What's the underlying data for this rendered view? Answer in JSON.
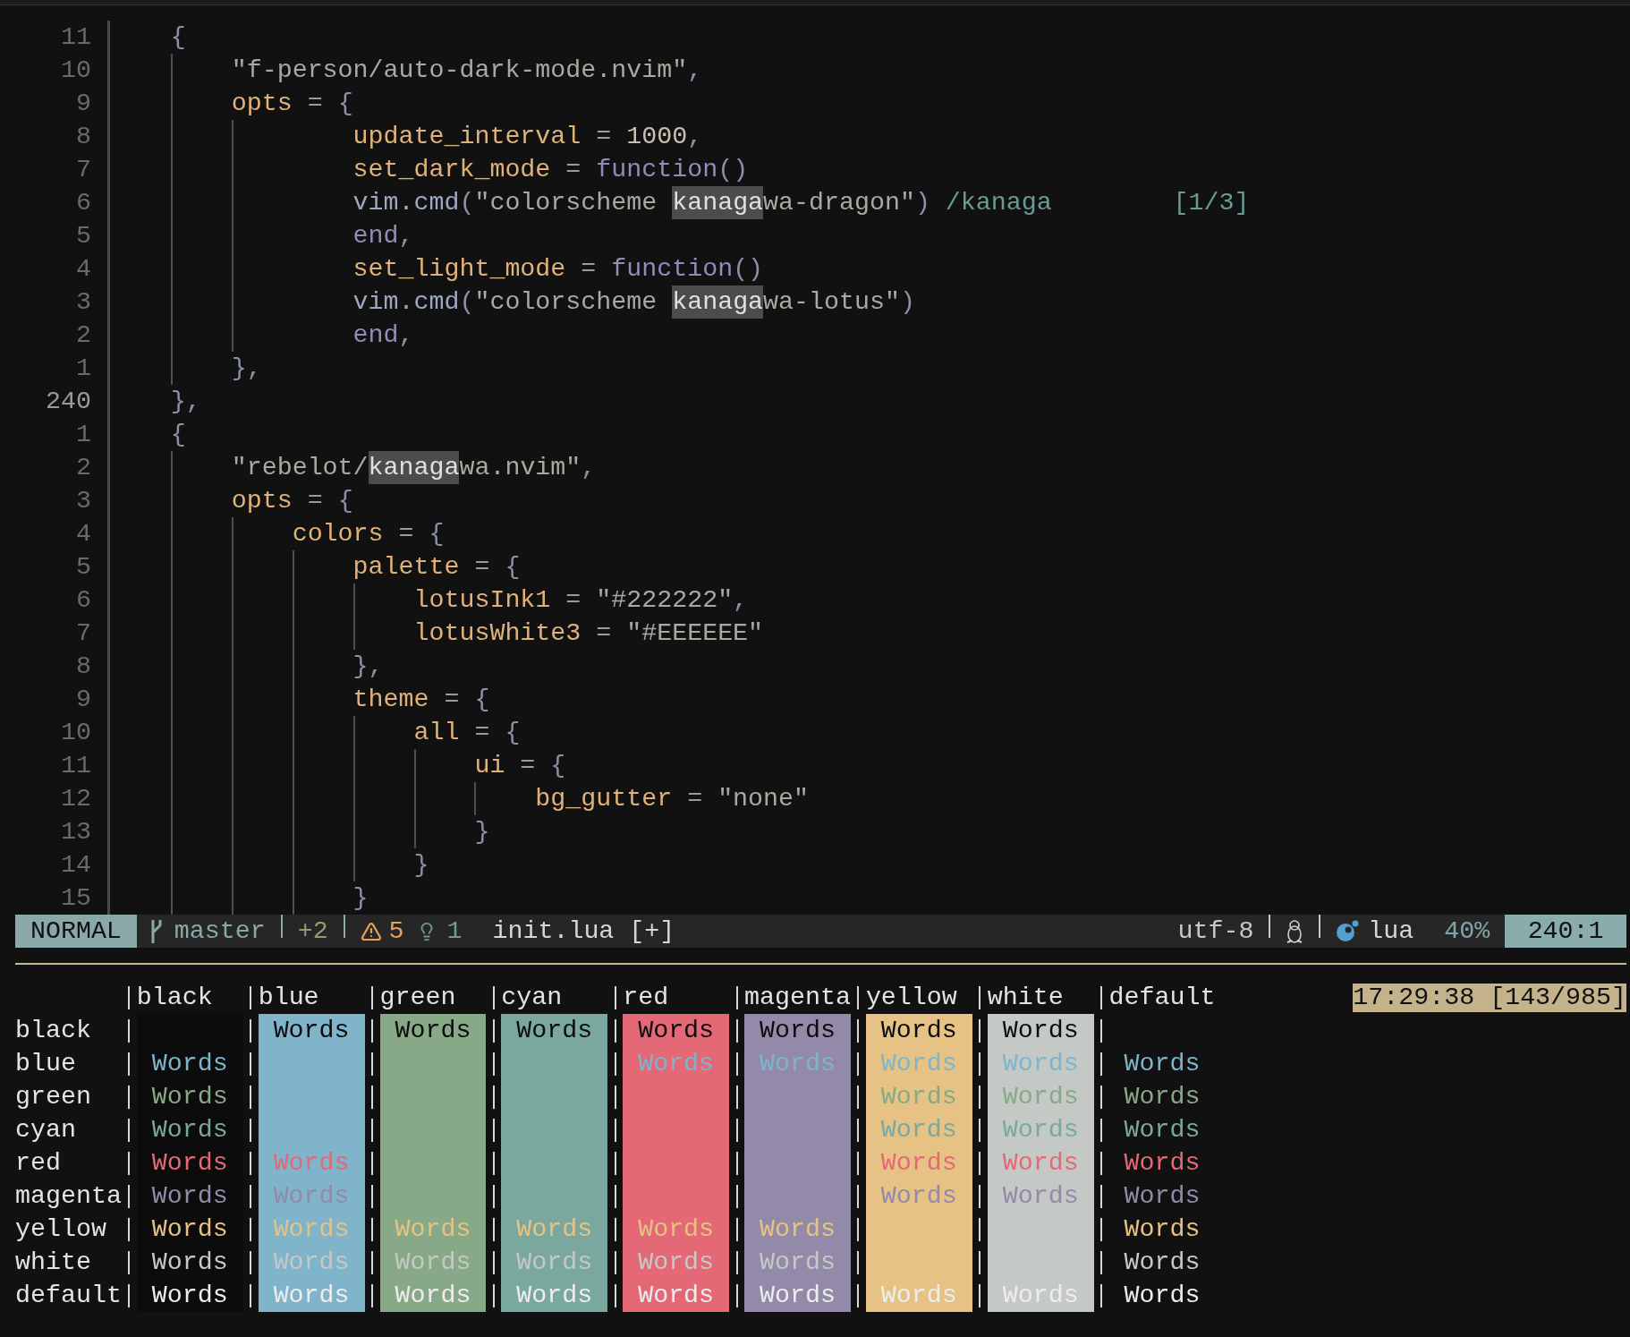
{
  "editor": {
    "lines": [
      {
        "number": "11",
        "current": false,
        "tokens": [
          {
            "kind": "punct",
            "text": "    {"
          }
        ]
      },
      {
        "number": "10",
        "current": false,
        "tokens": [
          {
            "kind": "string",
            "text": "        \"f-person/auto-dark-mode.nvim\""
          },
          {
            "kind": "punct",
            "text": ","
          }
        ]
      },
      {
        "number": "9",
        "current": false,
        "tokens": [
          {
            "kind": "key",
            "text": "        opts"
          },
          {
            "kind": "op",
            "text": " = "
          },
          {
            "kind": "punct",
            "text": "{"
          }
        ]
      },
      {
        "number": "8",
        "current": false,
        "tokens": [
          {
            "kind": "key",
            "text": "                update_interval"
          },
          {
            "kind": "op",
            "text": " = "
          },
          {
            "kind": "number",
            "text": "1000"
          },
          {
            "kind": "punct",
            "text": ","
          }
        ]
      },
      {
        "number": "7",
        "current": false,
        "tokens": [
          {
            "kind": "key",
            "text": "                set_dark_mode"
          },
          {
            "kind": "op",
            "text": " = "
          },
          {
            "kind": "keyword",
            "text": "function"
          },
          {
            "kind": "punct",
            "text": "()"
          }
        ]
      },
      {
        "number": "6",
        "current": false,
        "tokens": [
          {
            "kind": "call",
            "text": "                vim.cmd"
          },
          {
            "kind": "punct",
            "text": "("
          },
          {
            "kind": "string",
            "text": "\"colorscheme "
          },
          {
            "kind": "match",
            "text": "kanaga"
          },
          {
            "kind": "string",
            "text": "wa-dragon\""
          },
          {
            "kind": "punct",
            "text": ")"
          },
          {
            "kind": "hint",
            "text": "/kanaga"
          },
          {
            "kind": "count",
            "text": "[1/3]"
          }
        ]
      },
      {
        "number": "5",
        "current": false,
        "tokens": [
          {
            "kind": "keyword",
            "text": "                end"
          },
          {
            "kind": "punct",
            "text": ","
          }
        ]
      },
      {
        "number": "4",
        "current": false,
        "tokens": [
          {
            "kind": "key",
            "text": "                set_light_mode"
          },
          {
            "kind": "op",
            "text": " = "
          },
          {
            "kind": "keyword",
            "text": "function"
          },
          {
            "kind": "punct",
            "text": "()"
          }
        ]
      },
      {
        "number": "3",
        "current": false,
        "tokens": [
          {
            "kind": "call",
            "text": "                vim.cmd"
          },
          {
            "kind": "punct",
            "text": "("
          },
          {
            "kind": "string",
            "text": "\"colorscheme "
          },
          {
            "kind": "match",
            "text": "kanaga"
          },
          {
            "kind": "string",
            "text": "wa-lotus\""
          },
          {
            "kind": "punct",
            "text": ")"
          }
        ]
      },
      {
        "number": "2",
        "current": false,
        "tokens": [
          {
            "kind": "keyword",
            "text": "                end"
          },
          {
            "kind": "punct",
            "text": ","
          }
        ]
      },
      {
        "number": "1",
        "current": false,
        "tokens": [
          {
            "kind": "punct",
            "text": "        },"
          }
        ]
      },
      {
        "number": "240",
        "current": true,
        "tokens": [
          {
            "kind": "punct",
            "text": "    },"
          }
        ]
      },
      {
        "number": "1",
        "current": false,
        "tokens": [
          {
            "kind": "punct",
            "text": "    {"
          }
        ]
      },
      {
        "number": "2",
        "current": false,
        "tokens": [
          {
            "kind": "string",
            "text": "        \"rebelot/"
          },
          {
            "kind": "match",
            "text": "kanaga"
          },
          {
            "kind": "string",
            "text": "wa.nvim\""
          },
          {
            "kind": "punct",
            "text": ","
          }
        ]
      },
      {
        "number": "3",
        "current": false,
        "tokens": [
          {
            "kind": "key",
            "text": "        opts"
          },
          {
            "kind": "op",
            "text": " = "
          },
          {
            "kind": "punct",
            "text": "{"
          }
        ]
      },
      {
        "number": "4",
        "current": false,
        "tokens": [
          {
            "kind": "key",
            "text": "            colors"
          },
          {
            "kind": "op",
            "text": " = "
          },
          {
            "kind": "punct",
            "text": "{"
          }
        ]
      },
      {
        "number": "5",
        "current": false,
        "tokens": [
          {
            "kind": "key",
            "text": "                palette"
          },
          {
            "kind": "op",
            "text": " = "
          },
          {
            "kind": "punct",
            "text": "{"
          }
        ]
      },
      {
        "number": "6",
        "current": false,
        "tokens": [
          {
            "kind": "key",
            "text": "                    lotusInk1"
          },
          {
            "kind": "op",
            "text": " = "
          },
          {
            "kind": "string",
            "text": "\"#222222\""
          },
          {
            "kind": "punct",
            "text": ","
          }
        ]
      },
      {
        "number": "7",
        "current": false,
        "tokens": [
          {
            "kind": "key",
            "text": "                    lotusWhite3"
          },
          {
            "kind": "op",
            "text": " = "
          },
          {
            "kind": "string",
            "text": "\"#EEEEEE\""
          }
        ]
      },
      {
        "number": "8",
        "current": false,
        "tokens": [
          {
            "kind": "punct",
            "text": "                },"
          }
        ]
      },
      {
        "number": "9",
        "current": false,
        "tokens": [
          {
            "kind": "key",
            "text": "                theme"
          },
          {
            "kind": "op",
            "text": " = "
          },
          {
            "kind": "punct",
            "text": "{"
          }
        ]
      },
      {
        "number": "10",
        "current": false,
        "tokens": [
          {
            "kind": "key",
            "text": "                    all"
          },
          {
            "kind": "op",
            "text": " = "
          },
          {
            "kind": "punct",
            "text": "{"
          }
        ]
      },
      {
        "number": "11",
        "current": false,
        "tokens": [
          {
            "kind": "key",
            "text": "                        ui"
          },
          {
            "kind": "op",
            "text": " = "
          },
          {
            "kind": "punct",
            "text": "{"
          }
        ]
      },
      {
        "number": "12",
        "current": false,
        "tokens": [
          {
            "kind": "key",
            "text": "                            bg_gutter"
          },
          {
            "kind": "op",
            "text": " = "
          },
          {
            "kind": "string",
            "text": "\"none\""
          }
        ]
      },
      {
        "number": "13",
        "current": false,
        "tokens": [
          {
            "kind": "punct",
            "text": "                        }"
          }
        ]
      },
      {
        "number": "14",
        "current": false,
        "tokens": [
          {
            "kind": "punct",
            "text": "                    }"
          }
        ]
      },
      {
        "number": "15",
        "current": false,
        "tokens": [
          {
            "kind": "punct",
            "text": "                }"
          }
        ]
      }
    ]
  },
  "status_line": {
    "mode": "NORMAL",
    "branch": "master",
    "diff": "+2",
    "warnings": "5",
    "hints": "1",
    "file": "init.lua [+]",
    "encoding": "utf-8",
    "filetype": "lua",
    "progress": "40%",
    "position": "240:1"
  },
  "color_table": {
    "clock": "17:29:38 [143/985]",
    "columns": [
      {
        "label": "black",
        "color": "#0c0c0c"
      },
      {
        "label": "blue",
        "color": "#7fb4ca"
      },
      {
        "label": "green",
        "color": "#87a987"
      },
      {
        "label": "cyan",
        "color": "#7aa89f"
      },
      {
        "label": "red",
        "color": "#e46876"
      },
      {
        "label": "magenta",
        "color": "#938aa9"
      },
      {
        "label": "yellow",
        "color": "#e6c384"
      },
      {
        "label": "white",
        "color": "#c5c9c5"
      },
      {
        "label": "default"
      }
    ],
    "rows": [
      {
        "label": "black",
        "color": "#0c0c0c",
        "cells": [
          null,
          "Words",
          "Words",
          "Words",
          "Words",
          "Words",
          "Words",
          "Words",
          null
        ]
      },
      {
        "label": "blue",
        "color": "#7fb4ca",
        "cells": [
          "Words",
          null,
          null,
          null,
          "Words",
          "Words",
          "Words",
          "Words",
          "Words"
        ]
      },
      {
        "label": "green",
        "color": "#87a987",
        "cells": [
          "Words",
          null,
          null,
          null,
          null,
          null,
          "Words",
          "Words",
          "Words"
        ]
      },
      {
        "label": "cyan",
        "color": "#7aa89f",
        "cells": [
          "Words",
          null,
          null,
          null,
          null,
          null,
          "Words",
          "Words",
          "Words"
        ]
      },
      {
        "label": "red",
        "color": "#e46876",
        "cells": [
          "Words",
          "Words",
          null,
          null,
          null,
          null,
          "Words",
          "Words",
          "Words"
        ]
      },
      {
        "label": "magenta",
        "color": "#938aa9",
        "cells": [
          "Words",
          "Words",
          null,
          null,
          null,
          null,
          "Words",
          "Words",
          "Words"
        ]
      },
      {
        "label": "yellow",
        "color": "#e6c384",
        "cells": [
          "Words",
          "Words",
          "Words",
          "Words",
          "Words",
          "Words",
          null,
          null,
          "Words"
        ]
      },
      {
        "label": "white",
        "color": "#c5c9c5",
        "cells": [
          "Words",
          "Words",
          "Words",
          "Words",
          "Words",
          "Words",
          null,
          null,
          "Words"
        ]
      },
      {
        "label": "default",
        "color": "#ededed",
        "cells": [
          "Words",
          "Words",
          "Words",
          "Words",
          "Words",
          "Words",
          "Words",
          "Words",
          "Words"
        ]
      }
    ]
  }
}
